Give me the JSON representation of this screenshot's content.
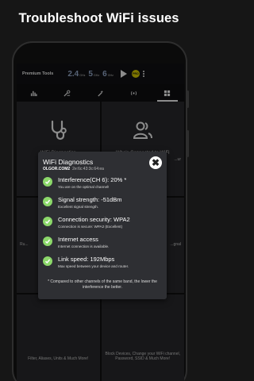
{
  "promo": {
    "headline": "Troubleshoot WiFi issues"
  },
  "appbar": {
    "title": "Premium Tools",
    "bands": [
      {
        "value": "2.4",
        "unit": "GHz"
      },
      {
        "value": "5",
        "unit": "GHz"
      },
      {
        "value": "6",
        "unit": "GHz"
      }
    ],
    "pro_badge": "PRO"
  },
  "tabs": [
    {
      "icon": "bar-chart-icon"
    },
    {
      "icon": "tools-icon"
    },
    {
      "icon": "magic-wand-icon"
    },
    {
      "icon": "wifi-signal-icon"
    },
    {
      "icon": "grid-icon",
      "active": true
    }
  ],
  "tiles": [
    {
      "icon": "stethoscope-icon",
      "title": "WiFi Diagnostics",
      "desc": ""
    },
    {
      "icon": "users-icon",
      "title": "Who's Connected to WiFi",
      "desc": "...ur"
    },
    {
      "icon": "",
      "title": "",
      "desc": "Ru..."
    },
    {
      "icon": "",
      "title": "",
      "desc": "...gnal"
    },
    {
      "icon": "",
      "title": "",
      "desc": "Filter, Aliases, Units & Much More!"
    },
    {
      "icon": "",
      "title": "",
      "desc": "Block Devices, Change your WiFi channel, Password, SSID & Much More!"
    }
  ],
  "dialog": {
    "title": "WiFi Diagnostics",
    "ssid": "OLGOR.COM2",
    "bssid": "2e:6c:43:3c:64:ea",
    "items": [
      {
        "title": "Interference(CH 6): 20% *",
        "detail": "You are on the optimal channel!"
      },
      {
        "title": "Signal strength: -51dBm",
        "detail": "Excellent signal strength."
      },
      {
        "title": "Connection security: WPA2",
        "detail": "Connection is secure: WPA2 (Excellent)"
      },
      {
        "title": "Internet access",
        "detail": "Internet connection is available."
      },
      {
        "title": "Link speed: 192Mbps",
        "detail": "Max speed between your device and router."
      }
    ],
    "footnote": "* Compared to other channels of the same band, the lower the interference the better.",
    "close_label": "✖"
  },
  "colors": {
    "check": "#8cd86a",
    "band_text": "#9fb4d8",
    "pro_badge": "#e6d800"
  }
}
